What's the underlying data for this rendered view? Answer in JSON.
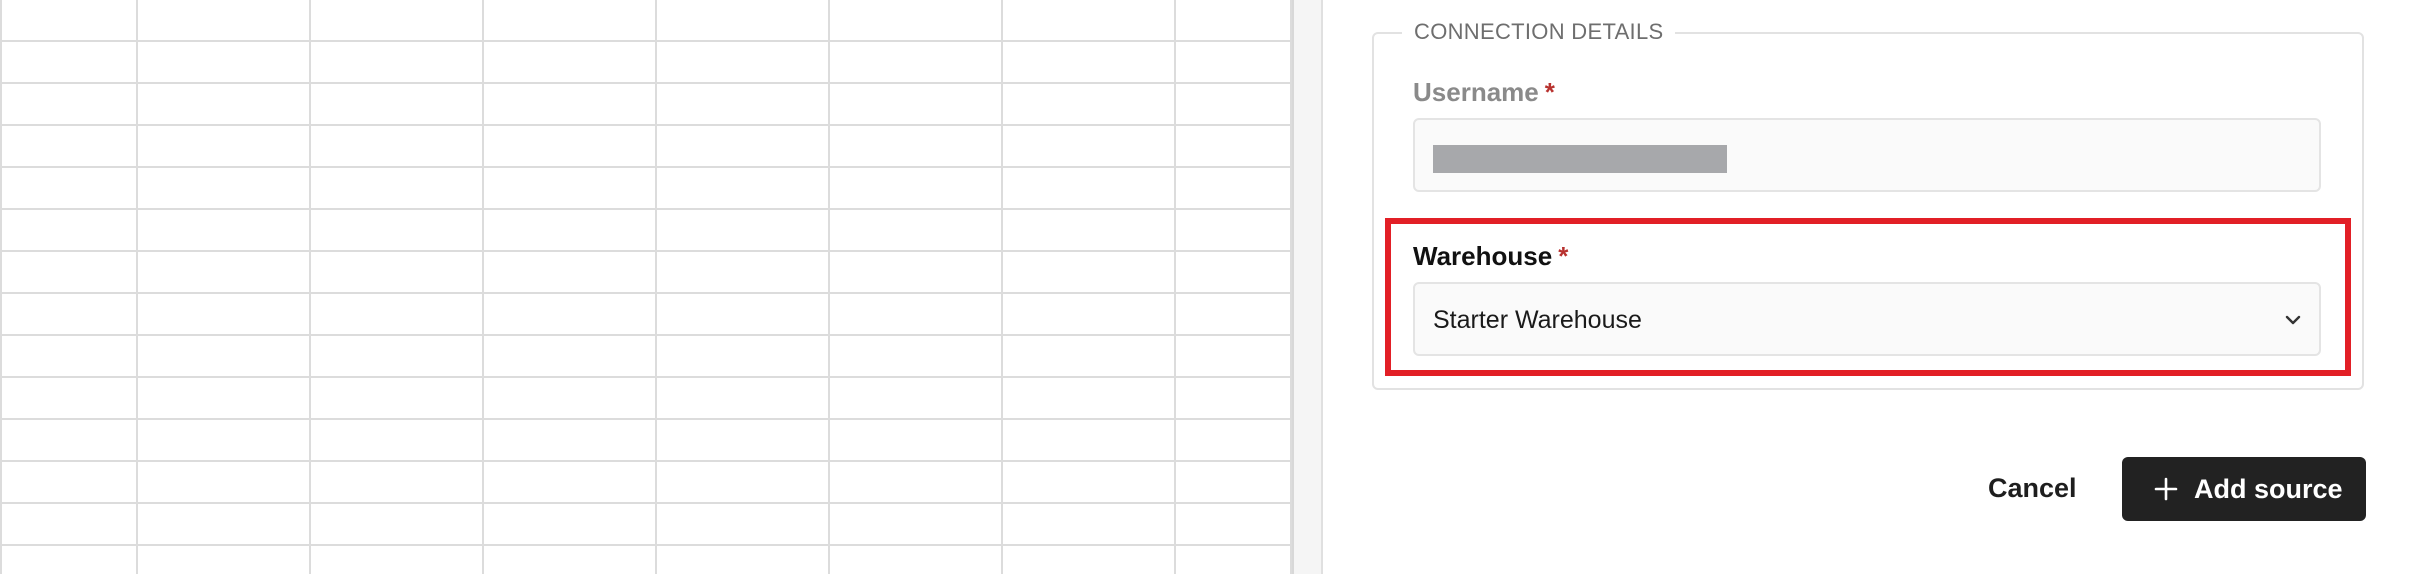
{
  "connection_details": {
    "legend": "CONNECTION DETAILS",
    "username": {
      "label": "Username",
      "required_mark": "*"
    },
    "warehouse": {
      "label": "Warehouse",
      "required_mark": "*",
      "selected": "Starter Warehouse",
      "dropdown_icon": "chevron-down-icon"
    }
  },
  "actions": {
    "cancel_label": "Cancel",
    "add_label": "Add source",
    "add_icon": "plus-icon"
  },
  "colors": {
    "highlight": "#e21f26",
    "primary_button": "#222222",
    "required": "#b8322f",
    "redaction": "#a7a8ab"
  }
}
